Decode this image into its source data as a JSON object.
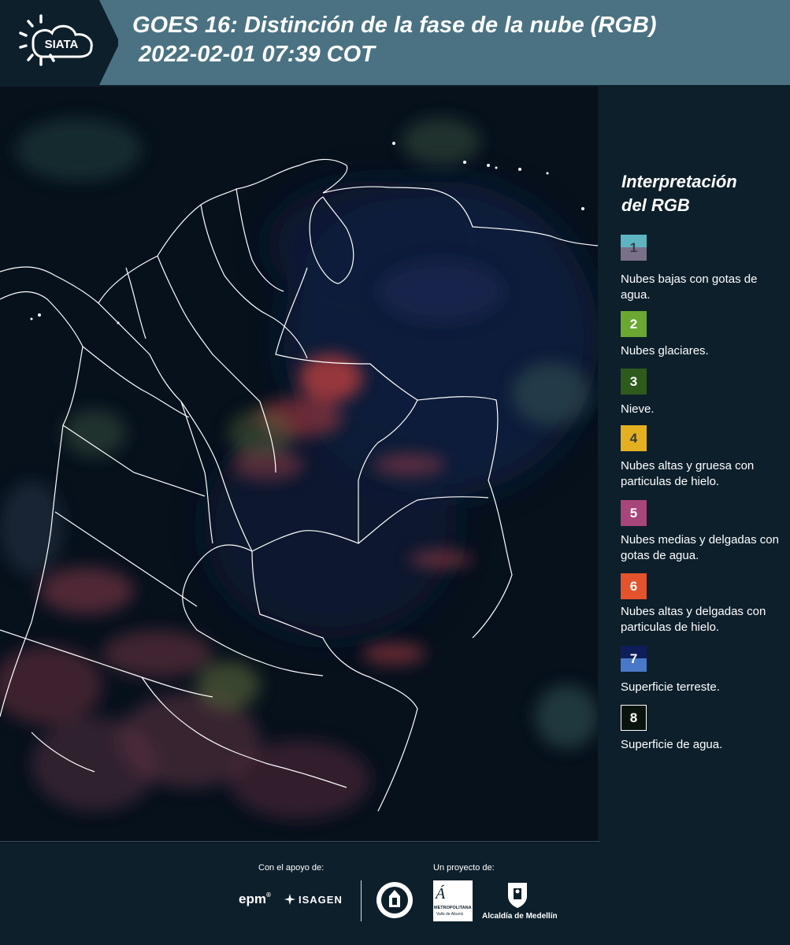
{
  "header": {
    "logo_text": "SIATA",
    "title_line1": "GOES 16: Distinción de la fase de la nube (RGB)",
    "title_line2": " 2022-02-01 07:39 COT",
    "background": "#4a7282"
  },
  "map": {
    "description_icon": "satellite-rgb-map",
    "background": "#07111c"
  },
  "legend": {
    "title_line1": "Interpretación",
    "title_line2": "del RGB",
    "items": [
      {
        "number": "1",
        "label": "Nubes bajas con gotas de agua.",
        "color_top": "#5fb4c2",
        "color_bottom": "#7a708a",
        "text_color": "#3a3a48"
      },
      {
        "number": "2",
        "label": "Nubes glaciares.",
        "color_top": "#6aa832",
        "color_bottom": "#6aa832",
        "text_color": "#ffffff"
      },
      {
        "number": "3",
        "label": "Nieve.",
        "color_top": "#2e5a1c",
        "color_bottom": "#2e5a1c",
        "text_color": "#ffffff"
      },
      {
        "number": "4",
        "label": "Nubes altas y gruesa con particulas de hielo.",
        "color_top": "#e4b021",
        "color_bottom": "#e4b021",
        "text_color": "#3a3a3a"
      },
      {
        "number": "5",
        "label": "Nubes medias y delgadas con gotas de agua.",
        "color_top": "#a8457a",
        "color_bottom": "#a8457a",
        "text_color": "#ffffff"
      },
      {
        "number": "6",
        "label": "Nubes altas y delgadas con particulas de hielo.",
        "color_top": "#e4532b",
        "color_bottom": "#e4532b",
        "text_color": "#ffffff"
      },
      {
        "number": "7",
        "label": "Superficie terreste.",
        "color_top": "#0e1e5a",
        "color_bottom": "#4a78c8",
        "text_color": "#ffffff"
      },
      {
        "number": "8",
        "label": "Superficie de agua.",
        "color_top": "#0a140e",
        "color_bottom": "#0a140e",
        "text_color": "#ffffff"
      }
    ]
  },
  "footer": {
    "support_label": "Con el apoyo de:",
    "project_label": "Un proyecto de:",
    "sponsor1": "epm",
    "sponsor2": "ISAGEN",
    "partner_area": "METROPOLITANA",
    "partner_area_sub": "Valle de Aburrá",
    "partner_city": "Alcaldía de Medellín"
  }
}
